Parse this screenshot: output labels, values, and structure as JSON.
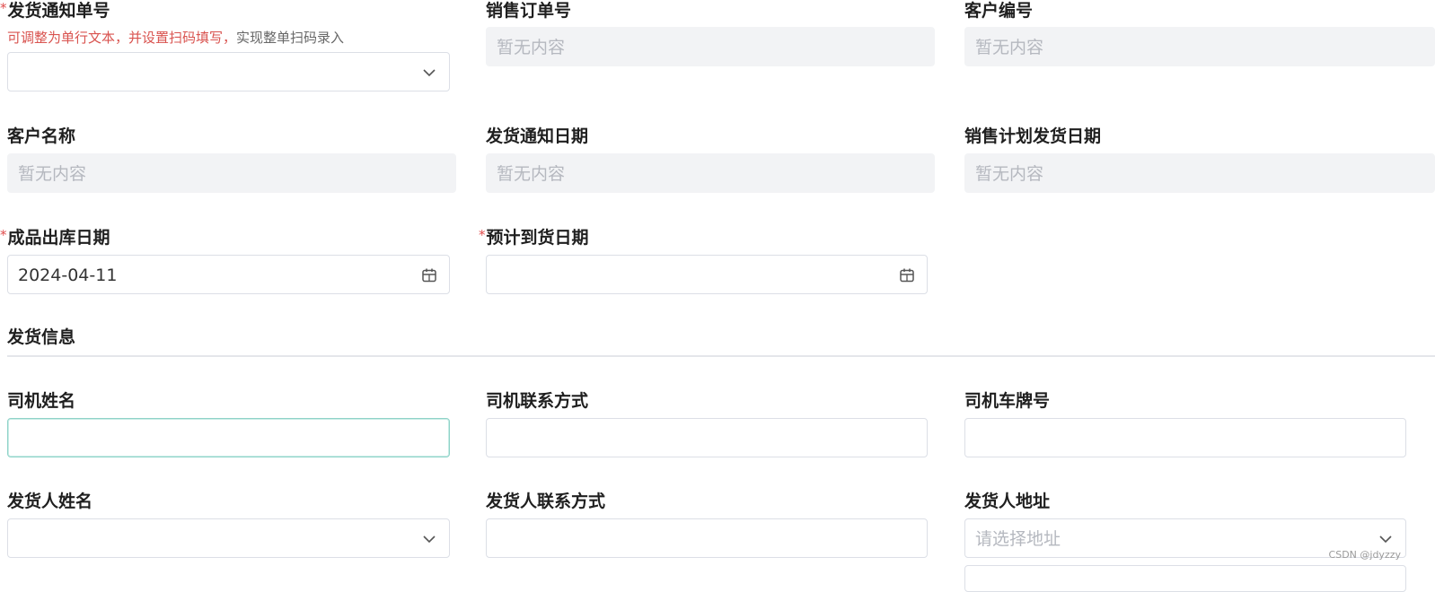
{
  "fields": {
    "notice_no": {
      "label": "发货通知单号",
      "required": true
    },
    "notice_hint": {
      "red": "可调整为单行文本，并设置扫码填写，",
      "gray": "实现整单扫码录入"
    },
    "sales_order_no": {
      "label": "销售订单号",
      "placeholder": "暂无内容"
    },
    "customer_code": {
      "label": "客户编号",
      "placeholder": "暂无内容"
    },
    "customer_name": {
      "label": "客户名称",
      "placeholder": "暂无内容"
    },
    "notice_date": {
      "label": "发货通知日期",
      "placeholder": "暂无内容"
    },
    "planned_ship_date": {
      "label": "销售计划发货日期",
      "placeholder": "暂无内容"
    },
    "outbound_date": {
      "label": "成品出库日期",
      "required": true,
      "value": "2024-04-11"
    },
    "expected_arrival": {
      "label": "预计到货日期",
      "required": true,
      "value": ""
    }
  },
  "section": {
    "title": "发货信息"
  },
  "shipping": {
    "driver_name": {
      "label": "司机姓名"
    },
    "driver_contact": {
      "label": "司机联系方式"
    },
    "plate_no": {
      "label": "司机车牌号"
    },
    "sender_name": {
      "label": "发货人姓名"
    },
    "sender_contact": {
      "label": "发货人联系方式"
    },
    "sender_address": {
      "label": "发货人地址",
      "placeholder": "请选择地址"
    }
  },
  "required_mark": "*",
  "watermark": "CSDN @jdyzzy",
  "icons": {
    "dropdown": "chevron-down-icon",
    "calendar": "calendar-icon"
  },
  "colors": {
    "required": "#e04b4b",
    "readonly_bg": "#f2f3f5",
    "focus_border": "#8fd3c8"
  }
}
